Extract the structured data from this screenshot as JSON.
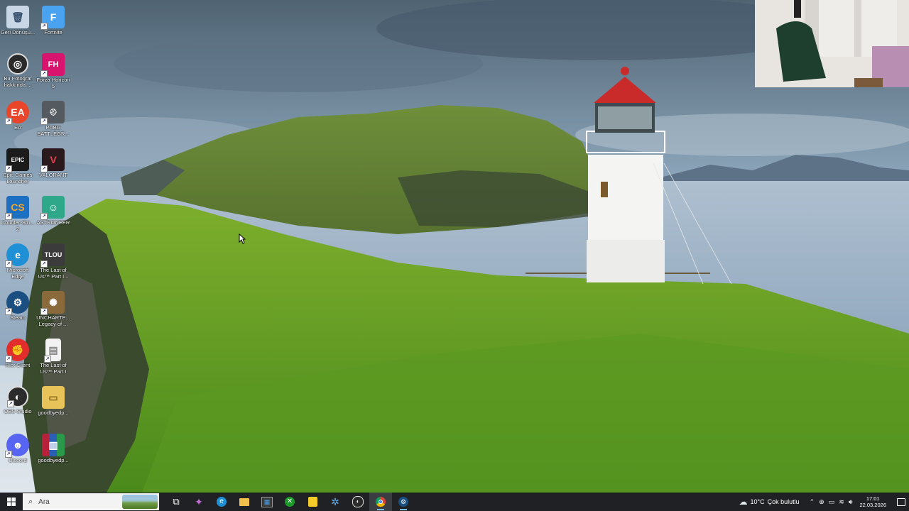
{
  "desktop": {
    "icons": [
      {
        "name": "recycle-bin-icon",
        "label": "Geri Dönüşü...",
        "color": "#c9d6e6"
      },
      {
        "name": "fortnite-icon",
        "label": "Fortnite",
        "color": "#4aa3f0"
      },
      {
        "name": "bu-fotograf-icon",
        "label": "Bu Fotoğraf hakkında ...",
        "color": "#2a2a2a"
      },
      {
        "name": "forza-horizon-icon",
        "label": "Forza Horizon 5",
        "color": "#d8146e"
      },
      {
        "name": "ea-icon",
        "label": "EA",
        "color": "#e8452a"
      },
      {
        "name": "pubg-icon",
        "label": "PUBG BATTLEGR...",
        "color": "#555a60"
      },
      {
        "name": "epic-games-icon",
        "label": "Epic Games Launcher",
        "color": "#1b1b1b"
      },
      {
        "name": "valorant-icon",
        "label": "VALORANT",
        "color": "#e0434f"
      },
      {
        "name": "counter-strike-icon",
        "label": "Counter-Stri... 2",
        "color": "#1d6fc2"
      },
      {
        "name": "astroneer-icon",
        "label": "ASTRONEER",
        "color": "#2fa88a"
      },
      {
        "name": "microsoft-edge-icon",
        "label": "Microsoft Edge",
        "color": "#1f8fd6"
      },
      {
        "name": "the-last-of-us-icon",
        "label": "The Last of Us™ Part I...",
        "color": "#3b3b3b"
      },
      {
        "name": "steam-icon",
        "label": "Steam",
        "color": "#1b4f82"
      },
      {
        "name": "uncharted-icon",
        "label": "UNCHARTE... Legacy of ...",
        "color": "#8a6a3a"
      },
      {
        "name": "riot-client-icon",
        "label": "Riot Client",
        "color": "#e32c2c"
      },
      {
        "name": "the-last-of-us-file-icon",
        "label": "The Last of Us™ Part I",
        "color": "#f2f2f2"
      },
      {
        "name": "obs-studio-icon",
        "label": "OBS Studio",
        "color": "#2b2b2b"
      },
      {
        "name": "goodbyedpi-folder-icon",
        "label": "goodbyedp...",
        "color": "#e8c35a"
      },
      {
        "name": "discord-icon",
        "label": "Discord",
        "color": "#5865f2"
      },
      {
        "name": "goodbyedpi-archive-icon",
        "label": "goodbyedp...",
        "color": "#b8213a"
      }
    ]
  },
  "taskbar": {
    "search_placeholder": "Ara",
    "apps": [
      {
        "name": "task-view-icon",
        "glyph": "⧉"
      },
      {
        "name": "copilot-icon",
        "glyph": "✦"
      },
      {
        "name": "edge-icon",
        "glyph": "e"
      },
      {
        "name": "file-explorer-icon",
        "glyph": "▬"
      },
      {
        "name": "microsoft-store-icon",
        "glyph": "▦"
      },
      {
        "name": "xbox-icon",
        "glyph": "⊗"
      },
      {
        "name": "sticky-notes-icon",
        "glyph": "▮"
      },
      {
        "name": "gear-app-icon",
        "glyph": "✲"
      },
      {
        "name": "obs-taskbar-icon",
        "glyph": "◉"
      },
      {
        "name": "chrome-icon",
        "glyph": "◎"
      },
      {
        "name": "steam-taskbar-icon",
        "glyph": "♨"
      }
    ],
    "weather": {
      "temp": "10°C",
      "condition": "Çok bulutlu"
    },
    "time": "17:01",
    "date": "22.03.2026"
  },
  "colors": {
    "taskbar_bg": "#1f2124",
    "accent": "#76b9ed"
  }
}
